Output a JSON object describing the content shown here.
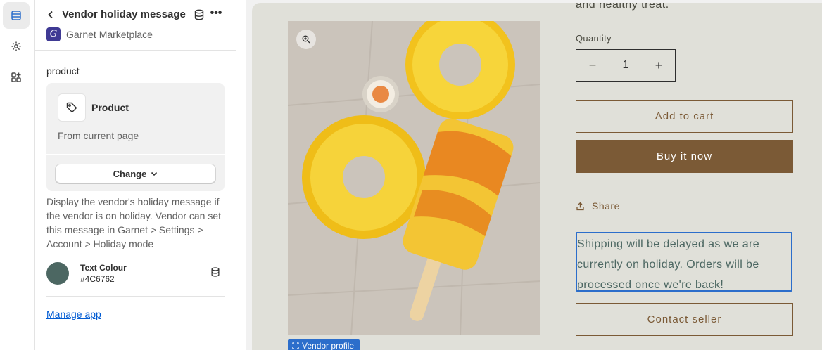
{
  "sidebar_icons": [
    "sections-icon",
    "gear-icon",
    "apps-icon"
  ],
  "header": {
    "title": "Vendor holiday message",
    "app_name": "Garnet Marketplace",
    "app_logo_letter": "G"
  },
  "settings": {
    "section_label": "product",
    "product_card": {
      "name": "Product",
      "source": "From current page",
      "change_label": "Change"
    },
    "help_text": "Display the vendor's holiday message if the vendor is on holiday. Vendor can set this message in Garnet > Settings > Account > Holiday mode",
    "text_colour": {
      "label": "Text Colour",
      "value": "#4C6762"
    },
    "manage_link": "Manage app"
  },
  "preview": {
    "cut_text": "and healthy treat.",
    "quantity_label": "Quantity",
    "quantity_value": "1",
    "qty_minus": "−",
    "qty_plus": "+",
    "add_to_cart": "Add to cart",
    "buy_now": "Buy it now",
    "share": "Share",
    "holiday_message": "Shipping will be delayed as we are currently on holiday. Orders will be processed once we're back!",
    "contact_seller": "Contact seller",
    "vendor_tag": "Vendor profile"
  },
  "colors": {
    "accent_brown": "#7B5A36",
    "highlight_blue": "#2C6ECB",
    "message_text": "#4C6762"
  }
}
